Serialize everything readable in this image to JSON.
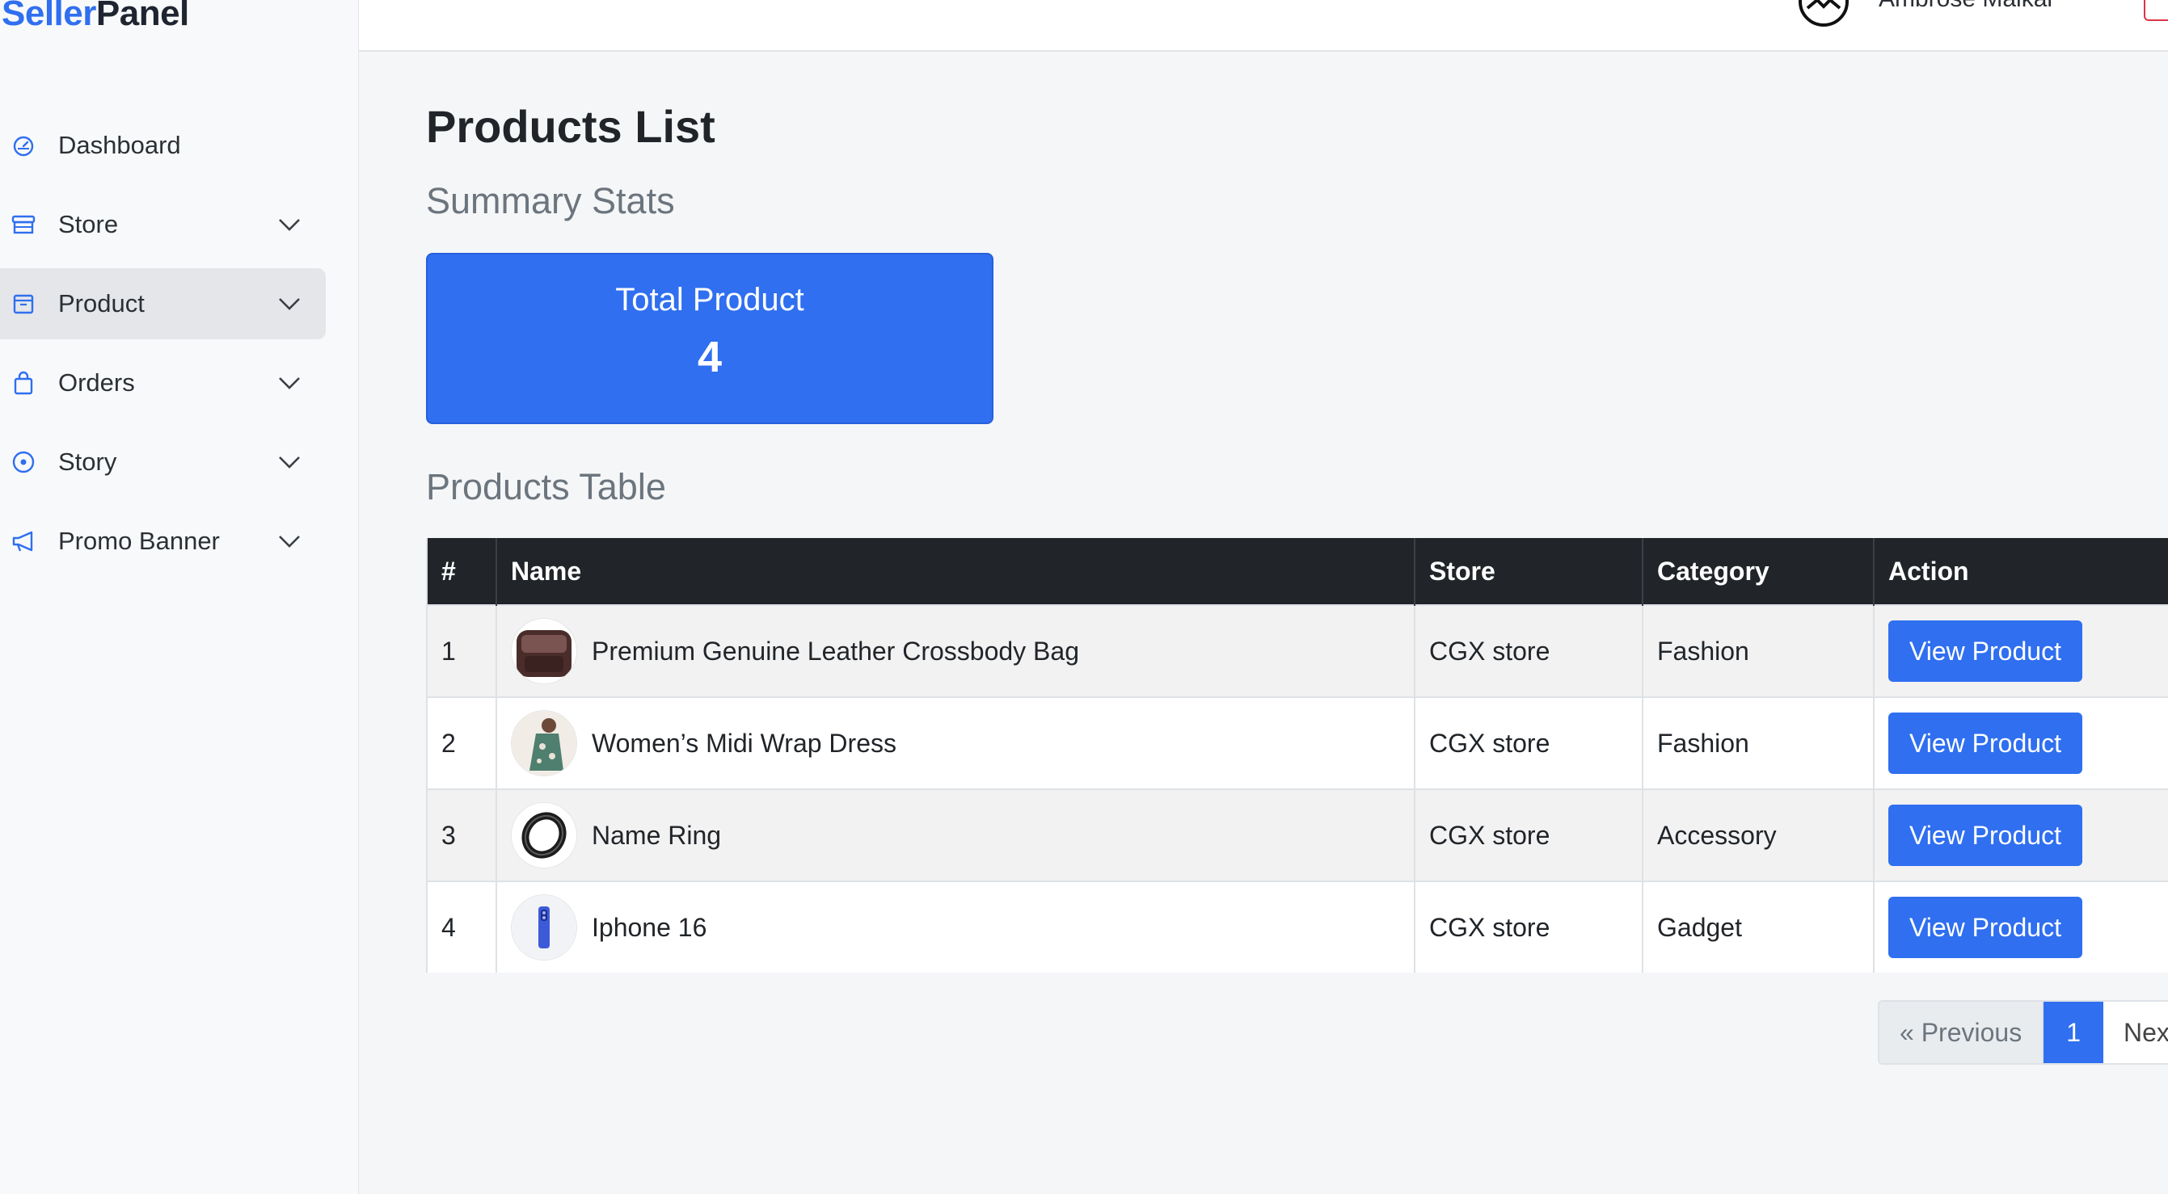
{
  "brand": {
    "part1": "Seller",
    "part2": "Panel"
  },
  "sidebar": {
    "items": [
      {
        "label": "Dashboard",
        "icon": "dashboard-gauge-icon",
        "has_chevron": false
      },
      {
        "label": "Store",
        "icon": "store-icon",
        "has_chevron": true
      },
      {
        "label": "Product",
        "icon": "box-icon",
        "has_chevron": true,
        "active": true
      },
      {
        "label": "Orders",
        "icon": "shopping-bag-icon",
        "has_chevron": true
      },
      {
        "label": "Story",
        "icon": "record-circle-icon",
        "has_chevron": true
      },
      {
        "label": "Promo Banner",
        "icon": "megaphone-icon",
        "has_chevron": true
      }
    ]
  },
  "topbar": {
    "user_name": "Ambrose Malkai"
  },
  "main": {
    "title": "Products List",
    "summary_title": "Summary Stats",
    "stat": {
      "label": "Total Product",
      "value": "4"
    },
    "table_title": "Products Table",
    "table": {
      "headers": [
        "#",
        "Name",
        "Store",
        "Category",
        "Action"
      ],
      "rows": [
        {
          "num": "1",
          "name": "Premium Genuine Leather Crossbody Bag",
          "store": "CGX store",
          "category": "Fashion",
          "action": "View Product",
          "thumb": "bag"
        },
        {
          "num": "2",
          "name": "Women’s Midi Wrap Dress",
          "store": "CGX store",
          "category": "Fashion",
          "action": "View Product",
          "thumb": "dress"
        },
        {
          "num": "3",
          "name": "Name Ring",
          "store": "CGX store",
          "category": "Accessory",
          "action": "View Product",
          "thumb": "ring"
        },
        {
          "num": "4",
          "name": "Iphone 16",
          "store": "CGX store",
          "category": "Gadget",
          "action": "View Product",
          "thumb": "phone"
        }
      ]
    },
    "pagination": {
      "previous": "« Previous",
      "current": "1",
      "next": "Next"
    }
  },
  "colors": {
    "accent": "#2f6ff0",
    "table_header": "#212529",
    "muted": "#6c757d"
  }
}
